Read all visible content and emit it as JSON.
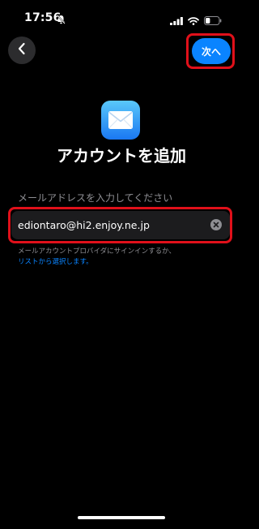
{
  "status_bar": {
    "time": "17:56",
    "battery_level": 0.35
  },
  "nav": {
    "back_icon": "chevron-left-icon",
    "next_label": "次へ"
  },
  "header": {
    "app_icon": "mail-icon",
    "title": "アカウントを追加"
  },
  "form": {
    "email_label": "メールアドレスを入力してください",
    "email_value": "ediontaro@hi2.enjoy.ne.jp",
    "clear_icon": "clear-x-icon"
  },
  "hint": {
    "line1": "メールアカウントプロバイダにサインインするか、",
    "link": "リストから選択します。"
  },
  "colors": {
    "accent": "#0a84ff",
    "highlight": "#e0101a",
    "background": "#000000",
    "field_bg": "#1c1c1e"
  }
}
